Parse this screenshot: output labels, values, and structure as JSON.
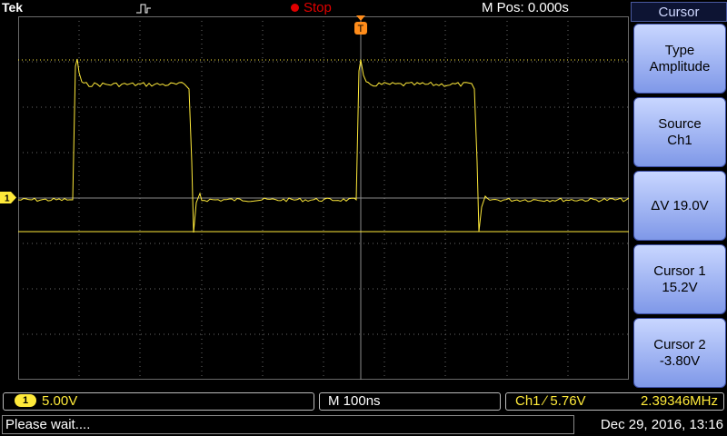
{
  "header": {
    "brand": "Tek",
    "run_state": "Stop",
    "m_pos": "M Pos: 0.000s"
  },
  "side_menu": {
    "title": "Cursor",
    "buttons": [
      {
        "line1": "Type",
        "line2": "Amplitude"
      },
      {
        "line1": "Source",
        "line2": "Ch1"
      },
      {
        "line1": "ΔV 19.0V",
        "line2": ""
      },
      {
        "line1": "Cursor 1",
        "line2": "15.2V"
      },
      {
        "line1": "Cursor 2",
        "line2": "-3.80V"
      }
    ]
  },
  "readouts": {
    "ch1_badge": "1",
    "ch1_scale": "5.00V",
    "timebase": "M 100ns",
    "trigger": "Ch1 ∕ 5.76V",
    "frequency": "2.39346MHz"
  },
  "status": {
    "message": "Please wait....",
    "datetime": "Dec 29, 2016, 13:16"
  },
  "markers": {
    "channel_marker": "1",
    "trigger_marker": "T"
  },
  "colors": {
    "trace": "#ffea3a",
    "grid": "#7a7a7a",
    "stop": "#e00000"
  }
}
